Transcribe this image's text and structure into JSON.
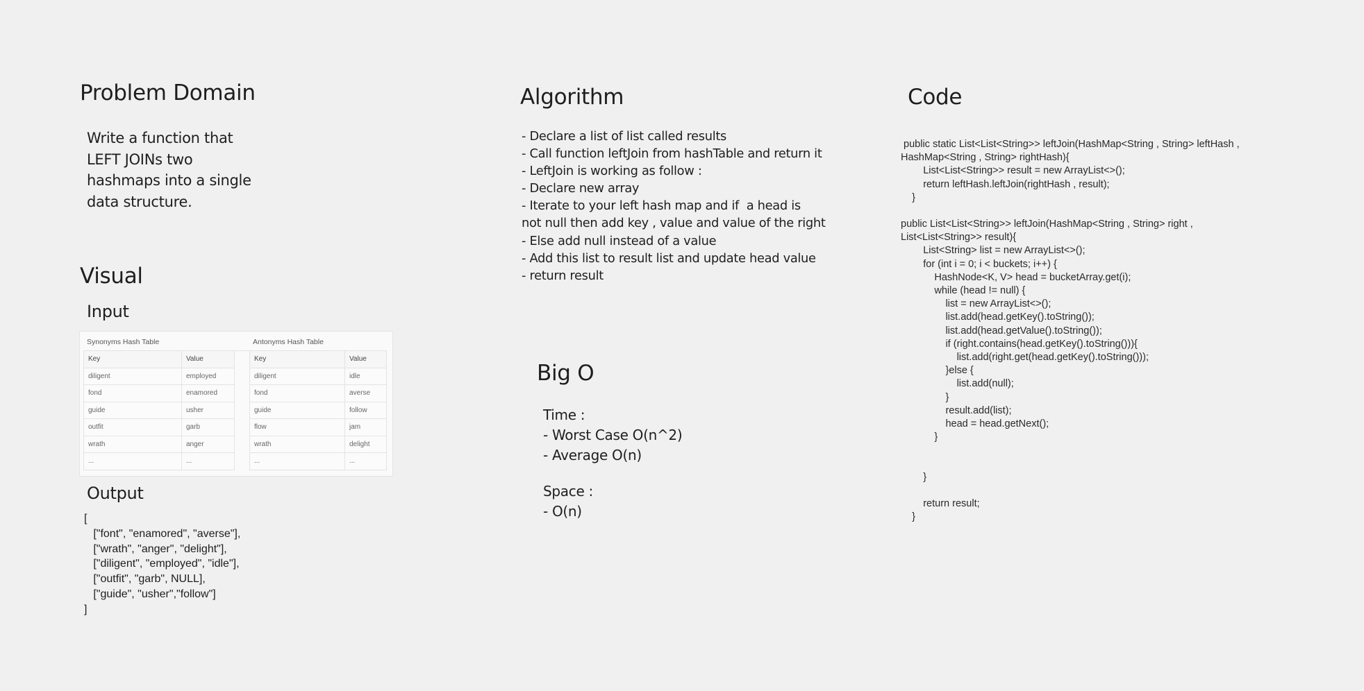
{
  "problem_domain": {
    "title": "Problem Domain",
    "text": "Write a function that\nLEFT JOINs two\nhashmaps into a single\ndata structure."
  },
  "visual": {
    "title": "Visual",
    "input_title": "Input",
    "output_title": "Output",
    "synonyms": {
      "caption": "Synonyms Hash Table",
      "headers": [
        "Key",
        "Value"
      ],
      "rows": [
        [
          "diligent",
          "employed"
        ],
        [
          "fond",
          "enamored"
        ],
        [
          "guide",
          "usher"
        ],
        [
          "outfit",
          "garb"
        ],
        [
          "wrath",
          "anger"
        ],
        [
          "...",
          "..."
        ]
      ]
    },
    "antonyms": {
      "caption": "Antonyms Hash Table",
      "headers": [
        "Key",
        "Value"
      ],
      "rows": [
        [
          "diligent",
          "idle"
        ],
        [
          "fond",
          "averse"
        ],
        [
          "guide",
          "follow"
        ],
        [
          "flow",
          "jam"
        ],
        [
          "wrath",
          "delight"
        ],
        [
          "...",
          "..."
        ]
      ]
    },
    "output": "[\n   [\"font\", \"enamored\", \"averse\"],\n   [\"wrath\", \"anger\", \"delight\"],\n   [\"diligent\", \"employed\", \"idle\"],\n   [\"outfit\", \"garb\", NULL],\n   [\"guide\", \"usher\",\"follow\"]\n]"
  },
  "algorithm": {
    "title": "Algorithm",
    "text": "- Declare a list of list called results\n- Call function leftJoin from hashTable and return it\n- LeftJoin is working as follow :\n- Declare new array\n- Iterate to your left hash map and if  a head is\nnot null then add key , value and value of the right\n- Else add null instead of a value\n- Add this list to result list and update head value\n- return result"
  },
  "big_o": {
    "title": "Big O",
    "time": "Time :\n- Worst Case O(n^2)\n- Average O(n)",
    "space": "Space :\n- O(n)"
  },
  "code": {
    "title": "Code",
    "block1": " public static List<List<String>> leftJoin(HashMap<String , String> leftHash ,\nHashMap<String , String> rightHash){\n        List<List<String>> result = new ArrayList<>();\n        return leftHash.leftJoin(rightHash , result);\n    }",
    "block2": "public List<List<String>> leftJoin(HashMap<String , String> right ,\nList<List<String>> result){\n        List<String> list = new ArrayList<>();\n        for (int i = 0; i < buckets; i++) {\n            HashNode<K, V> head = bucketArray.get(i);\n            while (head != null) {\n                list = new ArrayList<>();\n                list.add(head.getKey().toString());\n                list.add(head.getValue().toString());\n                if (right.contains(head.getKey().toString())){\n                    list.add(right.get(head.getKey().toString()));\n                }else {\n                    list.add(null);\n                }\n                result.add(list);\n                head = head.getNext();\n            }\n\n\n        }\n\n        return result;\n    }"
  }
}
